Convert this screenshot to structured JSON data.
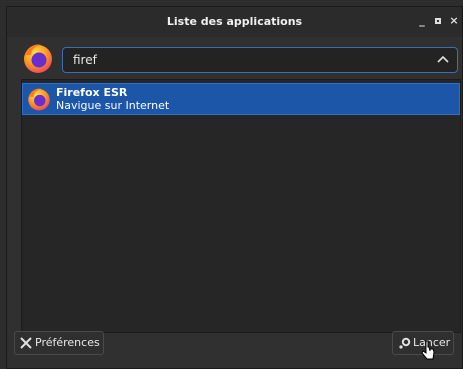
{
  "window": {
    "title": "Liste des applications",
    "controls": {
      "minimize": "_",
      "close": "×"
    }
  },
  "search": {
    "value": "firef",
    "expand_icon": "chevron-up-icon"
  },
  "results": [
    {
      "name": "Firefox ESR",
      "description": "Navigue sur Internet",
      "selected": true,
      "icon": "firefox-icon"
    }
  ],
  "footer": {
    "preferences_label": "Préférences",
    "launch_label": "Lancer"
  },
  "colors": {
    "selection": "#1c56a8",
    "focus_border": "#3d6fb0",
    "background": "#303030"
  }
}
